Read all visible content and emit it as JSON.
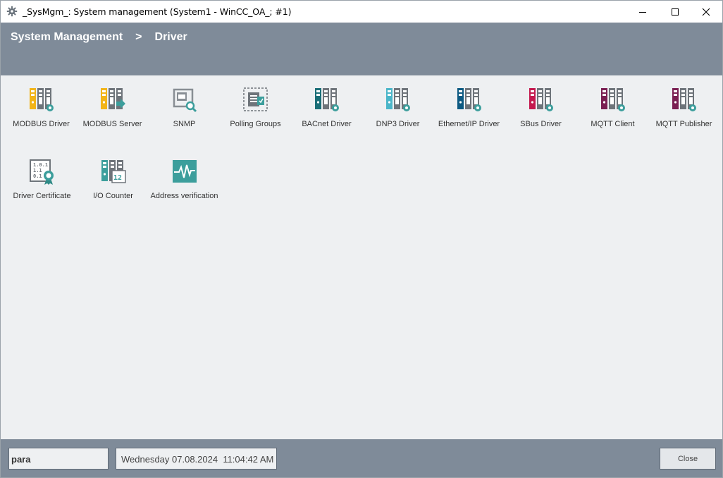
{
  "window": {
    "title": "_SysMgm_: System management (System1 - WinCC_OA_; #1)",
    "icon": "gear-icon"
  },
  "breadcrumb": {
    "root": "System Management",
    "separator": ">",
    "current": "Driver"
  },
  "tiles": [
    {
      "label": "MODBUS Driver",
      "icon": "driver-rack-icon",
      "color": "#f2b418"
    },
    {
      "label": "MODBUS Server",
      "icon": "server-rack-icon",
      "color": "#f2b418"
    },
    {
      "label": "SNMP",
      "icon": "snmp-search-icon",
      "color": "#888e94"
    },
    {
      "label": "Polling Groups",
      "icon": "polling-groups-icon",
      "color": "#3c9e9c"
    },
    {
      "label": "BACnet Driver",
      "icon": "driver-rack-icon",
      "color": "#1a6e77"
    },
    {
      "label": "DNP3 Driver",
      "icon": "driver-rack-icon",
      "color": "#4bb6c9"
    },
    {
      "label": "Ethernet/IP Driver",
      "icon": "driver-rack-icon",
      "color": "#0d5a82"
    },
    {
      "label": "SBus Driver",
      "icon": "driver-rack-icon",
      "color": "#c4194e"
    },
    {
      "label": "MQTT Client",
      "icon": "driver-rack-icon",
      "color": "#7a1f52"
    },
    {
      "label": "MQTT Publisher",
      "icon": "driver-rack-icon",
      "color": "#7a1f52"
    },
    {
      "label": "Driver Certificate",
      "icon": "certificate-icon",
      "color": "#3c9e9c"
    },
    {
      "label": "I/O Counter",
      "icon": "io-counter-icon",
      "color": "#3c9e9c"
    },
    {
      "label": "Address verification",
      "icon": "waveform-icon",
      "color": "#3c9e9c"
    }
  ],
  "footer": {
    "user": "para",
    "datetime": "Wednesday 07.08.2024  11:04:42 AM",
    "close_label": "Close"
  },
  "colors": {
    "header_bg": "#7f8b99",
    "content_bg": "#eef0f2",
    "rack_gray": "#6e747a"
  }
}
